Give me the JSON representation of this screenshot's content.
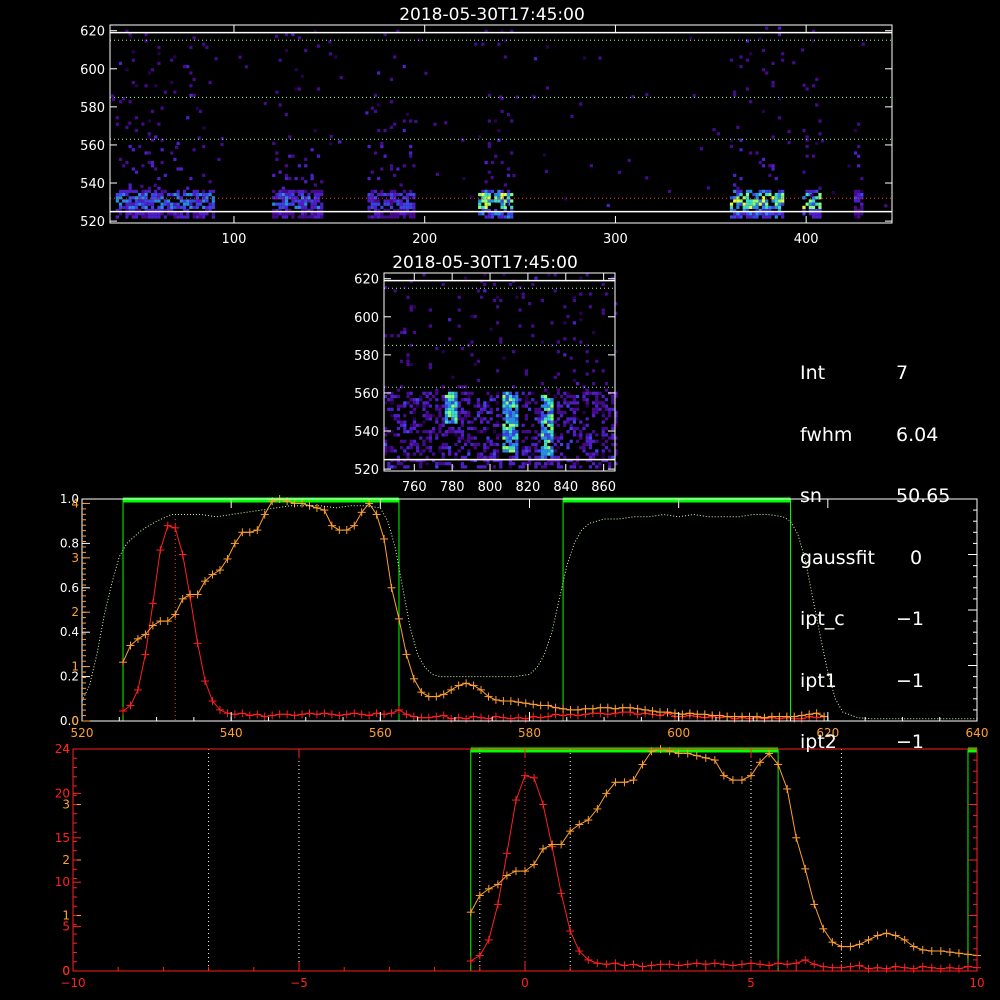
{
  "panel_top": {
    "title": "2018-05-30T17:45:00",
    "xticks": [
      100,
      200,
      300,
      400
    ],
    "yticks": [
      520,
      540,
      560,
      580,
      600,
      620
    ],
    "xlim": [
      35,
      445
    ],
    "ylim": [
      519,
      623
    ]
  },
  "panel_mid": {
    "title": "2018-05-30T17:45:00",
    "xticks": [
      760,
      780,
      800,
      820,
      840,
      860
    ],
    "yticks": [
      520,
      540,
      560,
      580,
      600,
      620
    ],
    "xlim": [
      744,
      866
    ],
    "ylim": [
      519,
      623
    ]
  },
  "info": {
    "rows": [
      {
        "key": "Int",
        "value": "7"
      },
      {
        "key": "fwhm",
        "value": "6.04"
      },
      {
        "key": "sn",
        "value": "50.65"
      },
      {
        "key": "gaussfit",
        "value": "0"
      },
      {
        "key": "ipt_c",
        "value": "−1"
      },
      {
        "key": "ipt1",
        "value": "−1"
      },
      {
        "key": "ipt2",
        "value": "−1"
      }
    ]
  },
  "colors": {
    "red": "#ff2020",
    "orange": "#ffa030",
    "green": "#00ff00",
    "white": "#ffffff",
    "light_green": "#ccffaa"
  },
  "chart_data": [
    {
      "type": "heatmap",
      "name": "panel_top",
      "xlim": [
        35,
        445
      ],
      "ylim": [
        519,
        623
      ],
      "horizontal_lines_white": [
        525,
        619
      ],
      "horizontal_lines_dotted_green": [
        563,
        585,
        615
      ],
      "horizontal_line_dotted_red": 532,
      "bright_columns": [
        {
          "x": [
            38,
            90
          ],
          "level": 0.5
        },
        {
          "x": [
            120,
            146
          ],
          "level": 0.45
        },
        {
          "x": [
            170,
            195
          ],
          "level": 0.4
        },
        {
          "x": [
            228,
            246
          ],
          "level": 0.85
        },
        {
          "x": [
            360,
            387
          ],
          "level": 0.8
        },
        {
          "x": [
            398,
            407
          ],
          "level": 0.75
        },
        {
          "x": [
            425,
            430
          ],
          "level": 0.35
        }
      ]
    },
    {
      "type": "heatmap",
      "name": "panel_mid",
      "xlim": [
        744,
        866
      ],
      "ylim": [
        519,
        623
      ],
      "horizontal_lines_white": [
        525,
        619
      ],
      "horizontal_lines_dotted_green": [
        563,
        585,
        615
      ],
      "bright_streaks": [
        {
          "x": 810,
          "y": [
            530,
            562
          ]
        },
        {
          "x": 830,
          "y": [
            526,
            560
          ]
        },
        {
          "x": 779,
          "y": [
            545,
            561
          ]
        }
      ]
    },
    {
      "type": "line",
      "name": "spectrum_wavelength",
      "xlim": [
        520,
        640
      ],
      "xticks": [
        520,
        540,
        560,
        580,
        600,
        620,
        640
      ],
      "left_ticks_white": [
        "0.0",
        "0.2",
        "0.4",
        "0.6",
        "0.8",
        "1.0"
      ],
      "left_ticks_orange": [
        "0",
        "1",
        "2",
        "3",
        "4"
      ],
      "green_windows": [
        [
          525.5,
          562.5
        ],
        [
          584.5,
          615
        ]
      ],
      "series": [
        {
          "color": "red",
          "x": [
            525.5,
            526.5,
            527.5,
            528.5,
            529.5,
            530.5,
            531.5,
            532.5,
            533.5,
            534.5,
            535.5,
            536.5,
            537.5,
            538.5,
            539.5,
            540.5,
            541.5,
            542.5,
            543.5,
            544.5,
            545.5,
            546.5,
            547.5,
            548.5,
            549.5,
            550.5,
            551.5,
            552.5,
            553.5,
            554.5,
            555.5,
            556.5,
            557.5,
            558.5,
            559.5,
            560.5,
            561.5,
            562.5,
            563.5,
            564.5,
            565.5,
            566.5,
            567.5,
            568.5,
            569.5,
            570.5,
            571.5,
            572.5,
            573.5,
            574.5,
            575.5,
            576.5,
            577.5,
            578.5,
            579.5,
            580.5,
            581.5,
            582.5,
            583.5,
            584.5,
            585.5,
            586.5,
            587.5,
            588.5,
            589.5,
            590.5,
            591.5,
            592.5,
            593.5,
            594.5,
            595.5,
            596.5,
            597.5,
            598.5,
            599.5,
            600.5,
            601.5,
            602.5,
            603.5,
            604.5,
            605.5,
            606.5,
            607.5,
            608.5,
            609.5,
            610.5,
            611.5,
            612.5,
            613.5,
            614.5,
            615.5,
            616.5,
            617.5,
            618.5,
            619.5
          ],
          "y": [
            0.045,
            0.07,
            0.14,
            0.3,
            0.53,
            0.77,
            0.88,
            0.87,
            0.75,
            0.56,
            0.35,
            0.18,
            0.09,
            0.05,
            0.035,
            0.03,
            0.035,
            0.025,
            0.03,
            0.02,
            0.025,
            0.03,
            0.03,
            0.025,
            0.03,
            0.035,
            0.03,
            0.035,
            0.03,
            0.025,
            0.03,
            0.035,
            0.03,
            0.025,
            0.035,
            0.03,
            0.035,
            0.05,
            0.03,
            0.02,
            0.015,
            0.015,
            0.02,
            0.025,
            0.01,
            0.015,
            0.01,
            0.02,
            0.015,
            0.01,
            0.02,
            0.015,
            0.01,
            0.015,
            0.01,
            0.02,
            0.015,
            0.02,
            0.03,
            0.025,
            0.03,
            0.025,
            0.03,
            0.035,
            0.035,
            0.03,
            0.035,
            0.04,
            0.04,
            0.03,
            0.035,
            0.03,
            0.025,
            0.035,
            0.02,
            0.02,
            0.025,
            0.02,
            0.015,
            0.02,
            0.015,
            0.02,
            0.01,
            0.015,
            0.01,
            0.015,
            0.01,
            0.015,
            0.01,
            0.015,
            0.01,
            0.01,
            0.02,
            0.015,
            0.02
          ]
        },
        {
          "color": "orange",
          "x": [
            525.5,
            526.5,
            527.5,
            528.5,
            529.5,
            530.5,
            531.5,
            532.5,
            533.5,
            534.5,
            535.5,
            536.5,
            537.5,
            538.5,
            539.5,
            540.5,
            541.5,
            542.5,
            543.5,
            544.5,
            545.5,
            546.5,
            547.5,
            548.5,
            549.5,
            550.5,
            551.5,
            552.5,
            553.5,
            554.5,
            555.5,
            556.5,
            557.5,
            558.5,
            559.5,
            560.5,
            561.5,
            562.5,
            563.5,
            564.5,
            565.5,
            566.5,
            567.5,
            568.5,
            569.5,
            570.5,
            571.5,
            572.5,
            573.5,
            574.5,
            575.5,
            576.5,
            577.5,
            578.5,
            579.5,
            580.5,
            581.5,
            582.5,
            583.5,
            584.5,
            585.5,
            586.5,
            587.5,
            588.5,
            589.5,
            590.5,
            591.5,
            592.5,
            593.5,
            594.5,
            595.5,
            596.5,
            597.5,
            598.5,
            599.5,
            600.5,
            601.5,
            602.5,
            603.5,
            604.5,
            605.5,
            606.5,
            607.5,
            608.5,
            609.5,
            610.5,
            611.5,
            612.5,
            613.5,
            614.5,
            615.5,
            616.5,
            617.5,
            618.5,
            619.5
          ],
          "y": [
            0.265,
            0.34,
            0.37,
            0.39,
            0.43,
            0.45,
            0.45,
            0.48,
            0.55,
            0.57,
            0.57,
            0.63,
            0.66,
            0.68,
            0.73,
            0.8,
            0.85,
            0.85,
            0.86,
            0.93,
            0.99,
            1.0,
            0.99,
            0.98,
            0.98,
            0.97,
            0.96,
            0.95,
            0.88,
            0.86,
            0.86,
            0.88,
            0.94,
            0.98,
            0.93,
            0.82,
            0.6,
            0.46,
            0.3,
            0.19,
            0.13,
            0.11,
            0.11,
            0.12,
            0.14,
            0.16,
            0.17,
            0.16,
            0.14,
            0.11,
            0.095,
            0.09,
            0.09,
            0.085,
            0.08,
            0.075,
            0.07,
            0.07,
            0.06,
            0.055,
            0.05,
            0.05,
            0.055,
            0.055,
            0.06,
            0.06,
            0.055,
            0.06,
            0.06,
            0.055,
            0.05,
            0.045,
            0.04,
            0.04,
            0.035,
            0.03,
            0.035,
            0.03,
            0.03,
            0.025,
            0.025,
            0.02,
            0.02,
            0.02,
            0.02,
            0.02,
            0.015,
            0.02,
            0.02,
            0.02,
            0.02,
            0.025,
            0.03,
            0.035,
            0.02
          ]
        },
        {
          "color": "light_green",
          "style": "dotted",
          "x": [
            520,
            521,
            522,
            523,
            524,
            525,
            526,
            527,
            528,
            530,
            532,
            534,
            536,
            538,
            540,
            542,
            544,
            546,
            548,
            550,
            552,
            554,
            556,
            558,
            560,
            561,
            562,
            563,
            564,
            565,
            566,
            567,
            568,
            570,
            572,
            574,
            576,
            578,
            580,
            581,
            582,
            583,
            584,
            585,
            586,
            587,
            588,
            590,
            592,
            594,
            596,
            598,
            600,
            602,
            604,
            606,
            608,
            610,
            612,
            614,
            615,
            616,
            617,
            618,
            619,
            620,
            621,
            622,
            624,
            626,
            628,
            630,
            632,
            634,
            636,
            638,
            640
          ],
          "y": [
            0.09,
            0.16,
            0.3,
            0.48,
            0.62,
            0.74,
            0.8,
            0.83,
            0.86,
            0.9,
            0.93,
            0.93,
            0.93,
            0.92,
            0.93,
            0.94,
            0.95,
            0.96,
            0.97,
            0.97,
            0.97,
            0.96,
            0.97,
            0.97,
            0.96,
            0.9,
            0.78,
            0.6,
            0.42,
            0.3,
            0.24,
            0.21,
            0.2,
            0.2,
            0.2,
            0.2,
            0.2,
            0.2,
            0.21,
            0.24,
            0.3,
            0.4,
            0.55,
            0.7,
            0.8,
            0.86,
            0.89,
            0.91,
            0.91,
            0.92,
            0.92,
            0.93,
            0.92,
            0.93,
            0.92,
            0.92,
            0.92,
            0.93,
            0.93,
            0.92,
            0.9,
            0.84,
            0.72,
            0.55,
            0.38,
            0.22,
            0.1,
            0.04,
            0.015,
            0.01,
            0.01,
            0.01,
            0.01,
            0.01,
            0.01,
            0.01,
            0.01
          ]
        }
      ]
    },
    {
      "type": "line",
      "name": "spectrum_velocity",
      "xlim": [
        -10,
        10
      ],
      "xticks": [
        -10,
        -5,
        0,
        5,
        10
      ],
      "left_ticks_orange": [
        "0",
        "1",
        "2",
        "3",
        "4"
      ],
      "left_ticks_red": [
        "0",
        "5",
        "10",
        "15",
        "20",
        "24"
      ],
      "dotted_vlines_white": [
        -7,
        -5,
        -1,
        1,
        5,
        7
      ],
      "dotted_vline_red": 0,
      "green_windows": [
        [
          -1.2,
          5.6
        ],
        [
          9.8,
          10
        ]
      ],
      "series": [
        {
          "color": "red",
          "x": [
            -1.2,
            -1.0,
            -0.8,
            -0.6,
            -0.4,
            -0.2,
            0.0,
            0.2,
            0.4,
            0.6,
            0.8,
            1.0,
            1.2,
            1.4,
            1.6,
            1.8,
            2.0,
            2.2,
            2.4,
            2.6,
            2.8,
            3.0,
            3.2,
            3.4,
            3.6,
            3.8,
            4.0,
            4.2,
            4.4,
            4.6,
            4.8,
            5.0,
            5.2,
            5.4,
            5.6,
            5.8,
            6.0,
            6.2,
            6.4,
            6.6,
            6.8,
            7.0,
            7.2,
            7.4,
            7.6,
            7.8,
            8.0,
            8.2,
            8.4,
            8.6,
            8.8,
            9.0,
            9.2,
            9.4,
            9.6,
            9.8,
            10.0
          ],
          "y": [
            0.045,
            0.07,
            0.14,
            0.3,
            0.53,
            0.77,
            0.88,
            0.87,
            0.75,
            0.56,
            0.35,
            0.18,
            0.09,
            0.05,
            0.035,
            0.03,
            0.035,
            0.025,
            0.03,
            0.02,
            0.025,
            0.03,
            0.03,
            0.025,
            0.03,
            0.035,
            0.03,
            0.035,
            0.03,
            0.025,
            0.03,
            0.035,
            0.03,
            0.025,
            0.035,
            0.03,
            0.035,
            0.05,
            0.03,
            0.02,
            0.015,
            0.015,
            0.02,
            0.025,
            0.01,
            0.015,
            0.01,
            0.02,
            0.015,
            0.01,
            0.02,
            0.015,
            0.01,
            0.015,
            0.01,
            0.02,
            0.015
          ]
        },
        {
          "color": "orange",
          "x": [
            -1.2,
            -1.0,
            -0.8,
            -0.6,
            -0.4,
            -0.2,
            0.0,
            0.2,
            0.4,
            0.6,
            0.8,
            1.0,
            1.2,
            1.4,
            1.6,
            1.8,
            2.0,
            2.2,
            2.4,
            2.6,
            2.8,
            3.0,
            3.2,
            3.4,
            3.6,
            3.8,
            4.0,
            4.2,
            4.4,
            4.6,
            4.8,
            5.0,
            5.2,
            5.4,
            5.6,
            5.8,
            6.0,
            6.2,
            6.4,
            6.6,
            6.8,
            7.0,
            7.2,
            7.4,
            7.6,
            7.8,
            8.0,
            8.2,
            8.4,
            8.6,
            8.8,
            9.0,
            9.2,
            9.4,
            9.6,
            9.8,
            10.0
          ],
          "y": [
            0.265,
            0.34,
            0.37,
            0.39,
            0.43,
            0.45,
            0.45,
            0.48,
            0.55,
            0.57,
            0.57,
            0.63,
            0.66,
            0.68,
            0.73,
            0.8,
            0.85,
            0.85,
            0.86,
            0.93,
            0.99,
            1.0,
            0.99,
            0.98,
            0.98,
            0.97,
            0.96,
            0.95,
            0.88,
            0.86,
            0.86,
            0.88,
            0.94,
            0.98,
            0.93,
            0.82,
            0.6,
            0.46,
            0.3,
            0.19,
            0.13,
            0.11,
            0.11,
            0.12,
            0.14,
            0.16,
            0.17,
            0.16,
            0.14,
            0.11,
            0.095,
            0.09,
            0.09,
            0.085,
            0.08,
            0.075,
            0.07
          ]
        }
      ]
    }
  ]
}
